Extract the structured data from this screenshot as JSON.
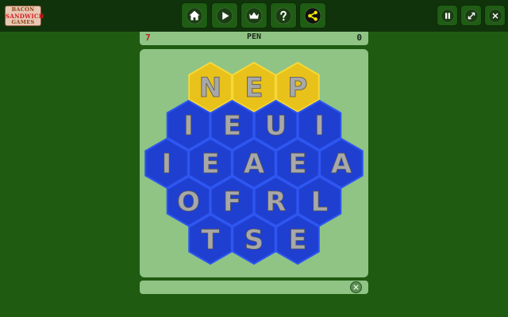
{
  "logo": {
    "line1": "BACON",
    "line2": "SANDWICH",
    "line3": "GAMES"
  },
  "toolbar": {
    "buttons": [
      {
        "name": "home",
        "icon": "home-icon"
      },
      {
        "name": "play",
        "icon": "play-icon"
      },
      {
        "name": "leaderboard",
        "icon": "crown-icon"
      },
      {
        "name": "help",
        "icon": "question-icon"
      },
      {
        "name": "share",
        "icon": "share-icon"
      }
    ],
    "right_buttons": [
      {
        "name": "pause",
        "icon": "pause-icon"
      },
      {
        "name": "fullscreen",
        "icon": "resize-icon"
      },
      {
        "name": "close",
        "icon": "close-icon"
      }
    ]
  },
  "score": {
    "left": "7",
    "word": "PEN",
    "right": "0"
  },
  "board": {
    "colors": {
      "blue": "#1f3fd1",
      "yellow": "#e8c21a",
      "letter": "#a8a8a8"
    },
    "rows": [
      {
        "cells": [
          {
            "letter": "N",
            "color": "yellow"
          },
          {
            "letter": "E",
            "color": "yellow"
          },
          {
            "letter": "P",
            "color": "yellow"
          }
        ]
      },
      {
        "cells": [
          {
            "letter": "I",
            "color": "blue"
          },
          {
            "letter": "E",
            "color": "blue"
          },
          {
            "letter": "U",
            "color": "blue"
          },
          {
            "letter": "I",
            "color": "blue"
          }
        ]
      },
      {
        "cells": [
          {
            "letter": "I",
            "color": "blue"
          },
          {
            "letter": "E",
            "color": "blue"
          },
          {
            "letter": "A",
            "color": "blue"
          },
          {
            "letter": "E",
            "color": "blue"
          },
          {
            "letter": "A",
            "color": "blue"
          }
        ]
      },
      {
        "cells": [
          {
            "letter": "O",
            "color": "blue"
          },
          {
            "letter": "F",
            "color": "blue"
          },
          {
            "letter": "R",
            "color": "blue"
          },
          {
            "letter": "L",
            "color": "blue"
          }
        ]
      },
      {
        "cells": [
          {
            "letter": "T",
            "color": "blue"
          },
          {
            "letter": "S",
            "color": "blue"
          },
          {
            "letter": "E",
            "color": "blue"
          }
        ]
      }
    ]
  },
  "word_bar": {
    "text": "",
    "clear_icon": "clear-icon"
  }
}
